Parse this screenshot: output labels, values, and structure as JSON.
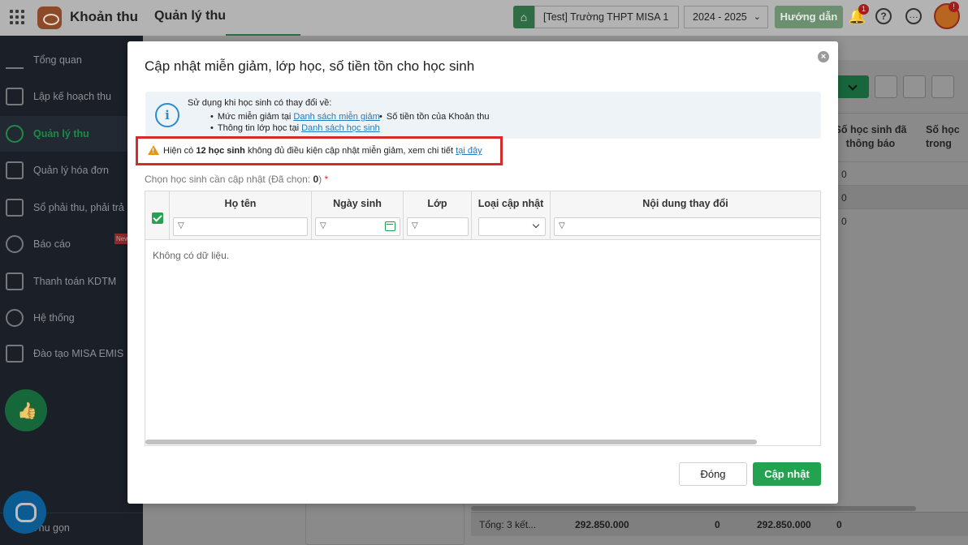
{
  "header": {
    "app_title": "Khoản thu",
    "module_title": "Quản lý thu",
    "school": "[Test] Trường THPT MISA 1",
    "year": "2024 - 2025",
    "guide_label": "Hướng dẫn",
    "notification_count": "1",
    "avatar_badge": "!"
  },
  "sidebar": {
    "items": [
      {
        "label": "Tổng quan"
      },
      {
        "label": "Lập kế hoạch thu"
      },
      {
        "label": "Quản lý thu"
      },
      {
        "label": "Quản lý hóa đơn"
      },
      {
        "label": "Sổ phải thu, phải trả"
      },
      {
        "label": "Báo cáo"
      },
      {
        "label": "Thanh toán KDTM"
      },
      {
        "label": "Hệ thống"
      },
      {
        "label": "Đào tạo MISA EMIS"
      }
    ],
    "active_index": 2,
    "new_badge": "New",
    "collapse_label": "Thu gọn"
  },
  "background_grid": {
    "col1_header": "Số học sinh đã thông báo",
    "col2_header": "Số học trong",
    "rows": [
      "0",
      "0",
      "0"
    ],
    "footer": {
      "total_label": "Tổng: 3 kết...",
      "amount": "292.850.000",
      "col_a": "0",
      "amount2": "292.850.000",
      "col_b": "0"
    }
  },
  "modal": {
    "title": "Cập nhật miễn giảm, lớp học, số tiền tồn cho học sinh",
    "info": {
      "heading": "Sử dụng khi học sinh có thay đổi về:",
      "line1_prefix": "Mức miễn giảm tại",
      "line1_link": "Danh sách miễn giảm",
      "line2_prefix": "Thông tin lớp học tại",
      "line2_link": "Danh sách học sinh",
      "line3": "Số tiền tồn của Khoản thu"
    },
    "warning": {
      "prefix": "Hiện có",
      "count": "12 học sinh",
      "middle": "không đủ điều kiện cập nhật miễn giảm, xem chi tiết",
      "link": "tại đây"
    },
    "select_label": "Chọn học sinh cần cập nhật (Đã chọn: ",
    "selected_count": "0",
    "select_label_end": ")",
    "required_mark": "*",
    "columns": {
      "name": "Họ tên",
      "dob": "Ngày sinh",
      "class": "Lớp",
      "update_type": "Loại cập nhật",
      "change": "Nội dung thay đổi"
    },
    "empty_text": "Không có dữ liệu.",
    "close_label": "Đóng",
    "update_label": "Cập nhật"
  },
  "colors": {
    "primary_green": "#23a34f",
    "link_blue": "#1f7bc2",
    "warning_border": "#d52b2b"
  }
}
